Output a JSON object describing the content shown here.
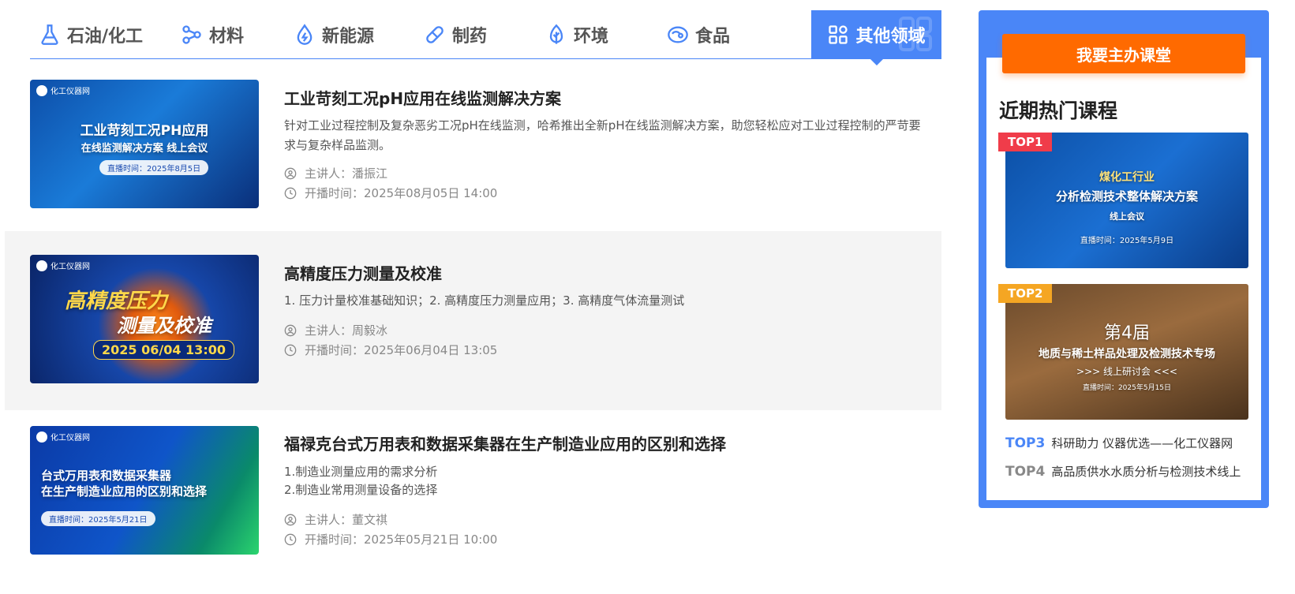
{
  "tabs": [
    {
      "label": "石油/化工",
      "icon": "flask-icon"
    },
    {
      "label": "材料",
      "icon": "molecule-icon"
    },
    {
      "label": "新能源",
      "icon": "energy-drop-icon"
    },
    {
      "label": "制药",
      "icon": "pill-icon"
    },
    {
      "label": "环境",
      "icon": "leaf-icon"
    },
    {
      "label": "食品",
      "icon": "food-icon"
    },
    {
      "label": "其他领域",
      "icon": "grid-icon",
      "active": true
    }
  ],
  "courses": [
    {
      "title": "工业苛刻工况pH应用在线监测解决方案",
      "desc": "针对工业过程控制及复杂恶劣工况pH在线监测，哈希推出全新pH在线监测解决方案，助您轻松应对工业过程控制的严苛要求与复杂样品监测。",
      "speaker": "主讲人：潘振江",
      "time": "开播时间：2025年08月05日 14:00",
      "thumb": {
        "brand": "化工仪器网",
        "line1": "工业苛刻工况PH应用",
        "line2": "在线监测解决方案 线上会议",
        "pill": "直播时间：2025年8月5日"
      }
    },
    {
      "title": "高精度压力测量及校准",
      "desc": "1. 压力计量校准基础知识；2. 高精度压力测量应用；3. 高精度气体流量测试",
      "speaker": "主讲人：周毅冰",
      "time": "开播时间：2025年06月04日 13:05",
      "thumb": {
        "brand": "化工仪器网",
        "line1": "高精度压力",
        "line2": "测量及校准",
        "pill": "2025 06/04 13:00"
      }
    },
    {
      "title": "福禄克台式万用表和数据采集器在生产制造业应用的区别和选择",
      "desc_lines": [
        "1.制造业测量应用的需求分析",
        "2.制造业常用测量设备的选择"
      ],
      "speaker": "主讲人：董文祺",
      "time": "开播时间：2025年05月21日 10:00",
      "thumb": {
        "brand": "化工仪器网",
        "line1": "台式万用表和数据采集器",
        "line2": "在生产制造业应用的区别和选择",
        "pill": "直播时间：2025年5月21日"
      }
    }
  ],
  "sidebar": {
    "host_button": "我要主办课堂",
    "title": "近期热门课程",
    "top_cards": [
      {
        "rank": "TOP1",
        "line1": "煤化工行业",
        "line2": "分析检测技术整体解决方案",
        "line3": "线上会议",
        "line4": "直播时间：2025年5月9日"
      },
      {
        "rank": "TOP2",
        "line1": "第4届",
        "line2": "地质与稀土样品处理及检测技术专场",
        "line3": ">>> 线上研讨会 <<<",
        "line4": "直播时间：2025年5月15日"
      }
    ],
    "links": [
      {
        "rank": "TOP3",
        "text": "科研助力 仪器优选——化工仪器网"
      },
      {
        "rank": "TOP4",
        "text": "高品质供水水质分析与检测技术线上"
      }
    ]
  },
  "colors": {
    "accent": "#4a86f7",
    "orange": "#ff6a00",
    "top1": "#f03c4a",
    "top2": "#f5a623"
  }
}
